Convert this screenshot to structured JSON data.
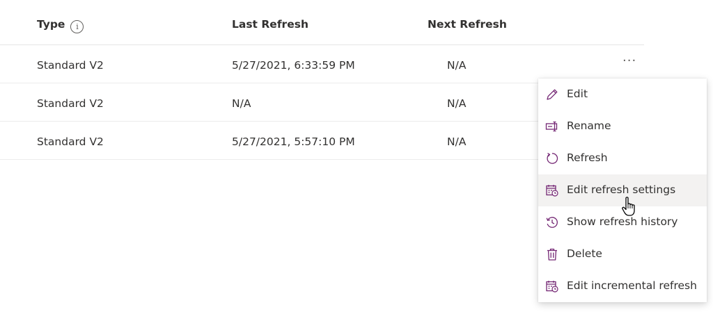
{
  "columns": {
    "type": "Type",
    "last_refresh": "Last Refresh",
    "next_refresh": "Next Refresh",
    "info_glyph": "i"
  },
  "rows": [
    {
      "type": "Standard V2",
      "last_refresh": "5/27/2021, 6:33:59 PM",
      "next_refresh": "N/A"
    },
    {
      "type": "Standard V2",
      "last_refresh": "N/A",
      "next_refresh": "N/A"
    },
    {
      "type": "Standard V2",
      "last_refresh": "5/27/2021, 5:57:10 PM",
      "next_refresh": "N/A"
    }
  ],
  "more_glyph": "···",
  "menu": {
    "items": [
      {
        "label": "Edit",
        "icon": "pencil-icon"
      },
      {
        "label": "Rename",
        "icon": "rename-icon"
      },
      {
        "label": "Refresh",
        "icon": "refresh-icon"
      },
      {
        "label": "Edit refresh settings",
        "icon": "calendar-clock-icon",
        "hovered": true
      },
      {
        "label": "Show refresh history",
        "icon": "history-icon"
      },
      {
        "label": "Delete",
        "icon": "trash-icon"
      },
      {
        "label": "Edit incremental refresh",
        "icon": "calendar-clock-icon"
      }
    ]
  },
  "colors": {
    "accent": "#742774",
    "text": "#323130",
    "hover": "#f3f2f1",
    "divider": "#e5e5e5"
  }
}
